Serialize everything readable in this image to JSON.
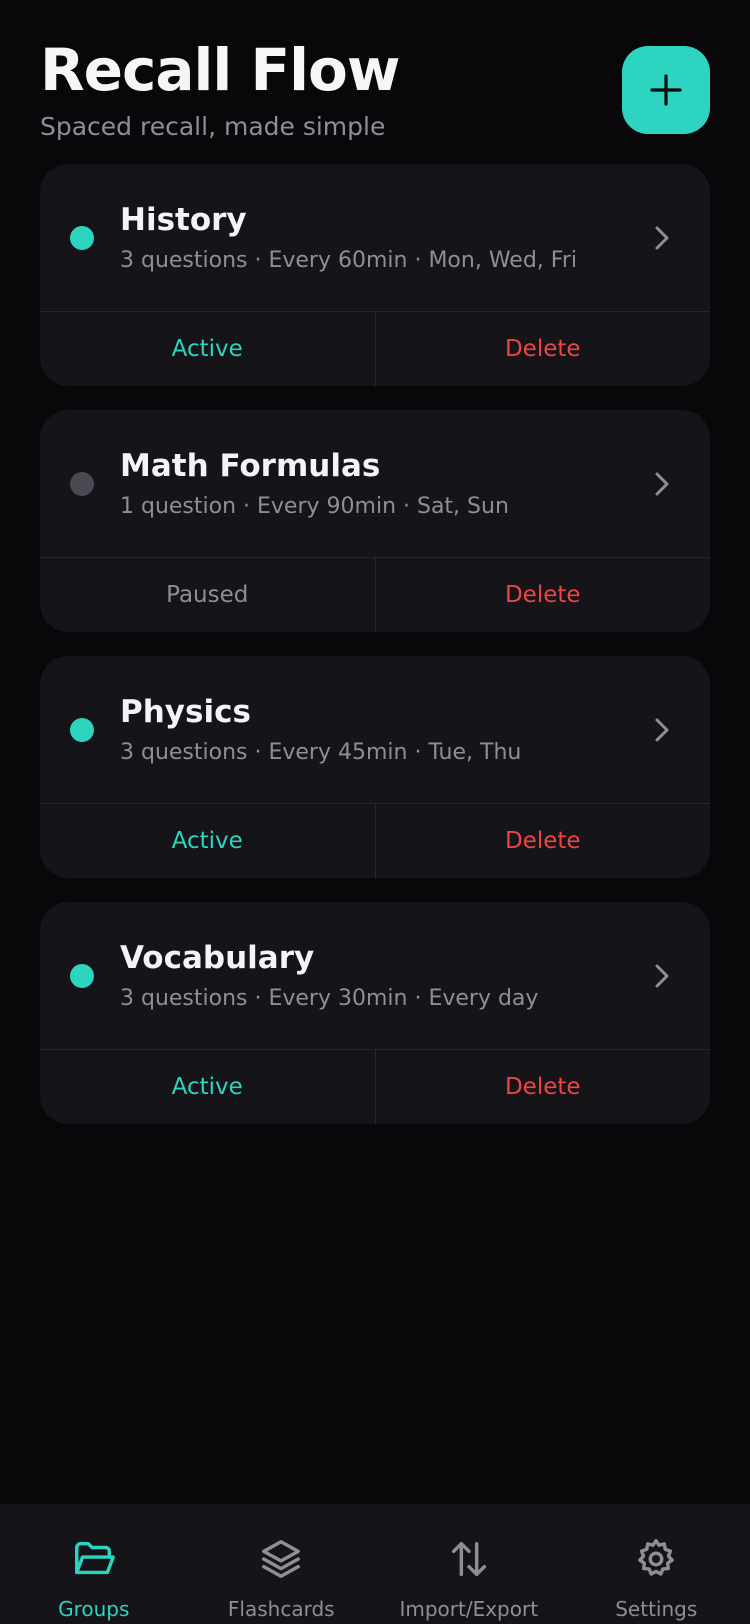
{
  "header": {
    "title": "Recall Flow",
    "subtitle": "Spaced recall, made simple",
    "add_icon": "plus-icon"
  },
  "colors": {
    "accent": "#2dd4bf",
    "danger": "#ef4444",
    "muted": "#8e8e97",
    "paused_dot": "#4a4a52",
    "card_bg": "#141419",
    "app_bg": "#08080a"
  },
  "groups": [
    {
      "name": "History",
      "meta": "3 questions · Every 60min · Mon, Wed, Fri",
      "status": "Active",
      "status_color": "#2dd4bf",
      "dot_color": "#2dd4bf",
      "delete_label": "Delete"
    },
    {
      "name": "Math Formulas",
      "meta": "1 question · Every 90min · Sat, Sun",
      "status": "Paused",
      "status_color": "#8e8e97",
      "dot_color": "#4a4a52",
      "delete_label": "Delete"
    },
    {
      "name": "Physics",
      "meta": "3 questions · Every 45min · Tue, Thu",
      "status": "Active",
      "status_color": "#2dd4bf",
      "dot_color": "#2dd4bf",
      "delete_label": "Delete"
    },
    {
      "name": "Vocabulary",
      "meta": "3 questions · Every 30min · Every day",
      "status": "Active",
      "status_color": "#2dd4bf",
      "dot_color": "#2dd4bf",
      "delete_label": "Delete"
    }
  ],
  "tabs": [
    {
      "label": "Groups",
      "icon": "folder-open-icon",
      "active": true
    },
    {
      "label": "Flashcards",
      "icon": "layers-icon",
      "active": false
    },
    {
      "label": "Import/Export",
      "icon": "arrows-up-down-icon",
      "active": false
    },
    {
      "label": "Settings",
      "icon": "gear-icon",
      "active": false
    }
  ]
}
